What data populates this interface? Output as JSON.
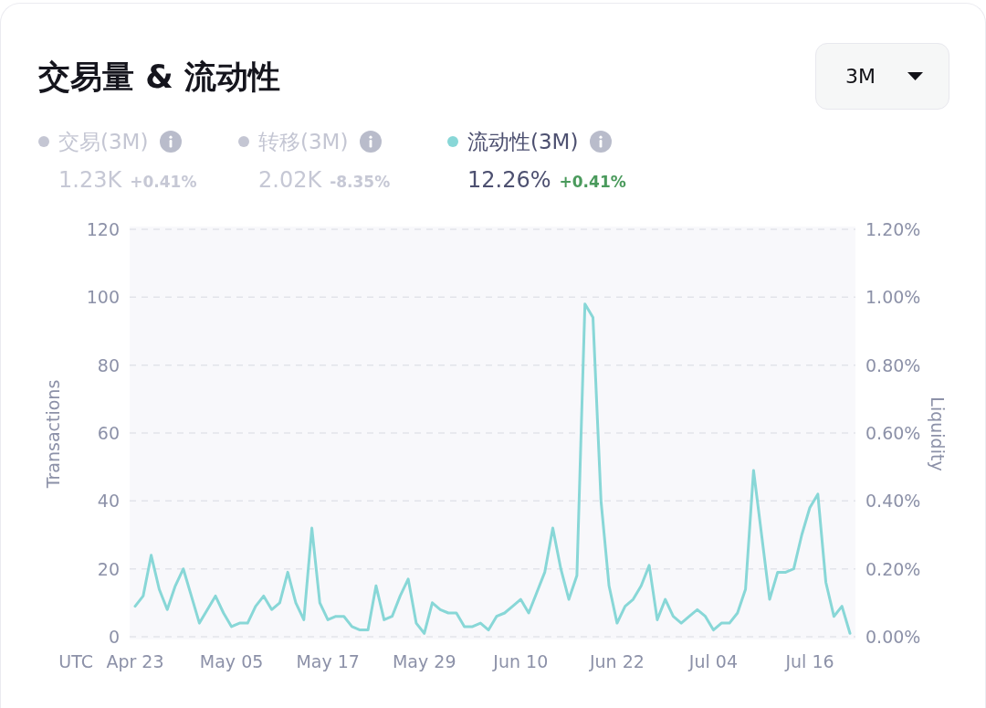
{
  "card": {
    "title": "交易量 & 流动性",
    "period_dropdown": {
      "value": "3M"
    }
  },
  "legend": [
    {
      "label": "交易(3M)",
      "on": false,
      "value": "1.23K",
      "change": "+0.41%"
    },
    {
      "label": "转移(3M)",
      "on": false,
      "value": "2.02K",
      "change": "-8.35%"
    },
    {
      "label": "流动性(3M)",
      "on": true,
      "value": "12.26%",
      "change": "+0.41%"
    }
  ],
  "chart": {
    "chart_data": {
      "type": "line",
      "grid": true,
      "xlabel": "UTC",
      "ylabel": "Transactions",
      "y2label": "Liquidity",
      "categories": [
        "Apr 23",
        null,
        null,
        null,
        null,
        null,
        null,
        null,
        null,
        null,
        null,
        null,
        "May 05",
        null,
        null,
        null,
        null,
        null,
        null,
        null,
        null,
        null,
        null,
        null,
        "May 17",
        null,
        null,
        null,
        null,
        null,
        null,
        null,
        null,
        null,
        null,
        null,
        "May 29",
        null,
        null,
        null,
        null,
        null,
        null,
        null,
        null,
        null,
        null,
        null,
        "Jun 10",
        null,
        null,
        null,
        null,
        null,
        null,
        null,
        null,
        null,
        null,
        null,
        "Jun 22",
        null,
        null,
        null,
        null,
        null,
        null,
        null,
        null,
        null,
        null,
        null,
        "Jul 04",
        null,
        null,
        null,
        null,
        null,
        null,
        null,
        null,
        null,
        null,
        null,
        "Jul 16",
        null,
        null,
        null,
        null,
        null
      ],
      "ylim": [
        0,
        120
      ],
      "yticks": [
        0,
        20,
        40,
        60,
        80,
        100,
        120
      ],
      "y2lim": [
        0,
        1.2
      ],
      "y2ticks": [
        {
          "value": 0,
          "label": "0.00%"
        },
        {
          "value": 0.2,
          "label": "0.20%"
        },
        {
          "value": 0.4,
          "label": "0.40%"
        },
        {
          "value": 0.6,
          "label": "0.60%"
        },
        {
          "value": 0.8,
          "label": "0.80%"
        },
        {
          "value": 1.0,
          "label": "1.00%"
        },
        {
          "value": 1.2,
          "label": "1.20%"
        }
      ],
      "series": [
        {
          "color": "#88d7d7",
          "axis": "y2",
          "values": [
            0.09,
            0.12,
            0.24,
            0.14,
            0.08,
            0.15,
            0.2,
            0.12,
            0.04,
            0.08,
            0.12,
            0.07,
            0.03,
            0.04,
            0.04,
            0.09,
            0.12,
            0.08,
            0.1,
            0.19,
            0.1,
            0.05,
            0.32,
            0.1,
            0.05,
            0.06,
            0.06,
            0.03,
            0.02,
            0.02,
            0.15,
            0.05,
            0.06,
            0.12,
            0.17,
            0.04,
            0.01,
            0.1,
            0.08,
            0.07,
            0.07,
            0.03,
            0.03,
            0.04,
            0.02,
            0.06,
            0.07,
            0.09,
            0.11,
            0.07,
            0.13,
            0.19,
            0.32,
            0.2,
            0.11,
            0.18,
            0.98,
            0.94,
            0.4,
            0.15,
            0.04,
            0.09,
            0.11,
            0.15,
            0.21,
            0.05,
            0.11,
            0.06,
            0.04,
            0.06,
            0.08,
            0.06,
            0.02,
            0.04,
            0.04,
            0.07,
            0.14,
            0.49,
            0.3,
            0.11,
            0.19,
            0.19,
            0.2,
            0.3,
            0.38,
            0.42,
            0.16,
            0.06,
            0.09,
            0.01
          ]
        }
      ]
    }
  }
}
